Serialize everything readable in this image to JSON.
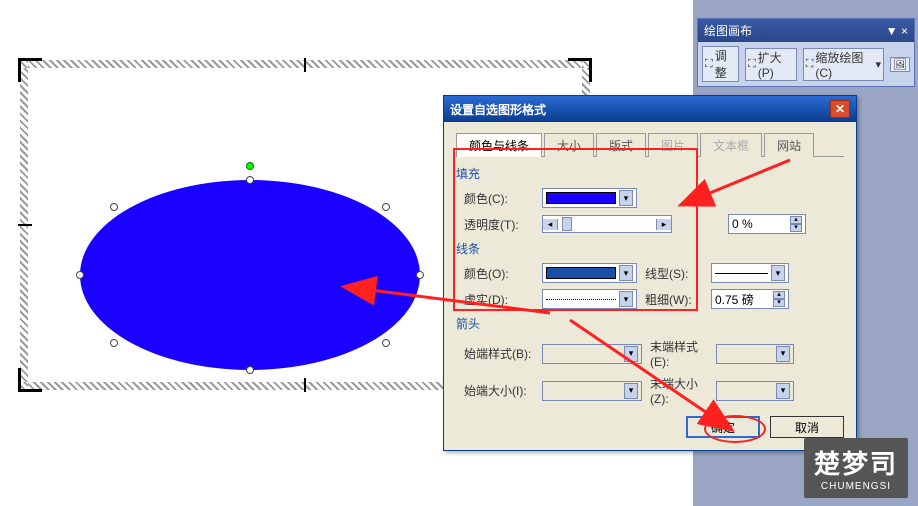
{
  "toolbar": {
    "title": "绘图画布",
    "adjust": "调整",
    "expand": "扩大(P)",
    "scale": "缩放绘图(C)"
  },
  "dialog": {
    "title": "设置自选图形格式",
    "tabs": {
      "colors": "颜色与线条",
      "size": "大小",
      "layout": "版式",
      "picture": "图片",
      "textbox": "文本框",
      "web": "网站"
    },
    "fill": {
      "section": "填充",
      "color_label": "颜色(C):",
      "color_value": "#1a00ff",
      "transparency_label": "透明度(T):",
      "transparency_value": "0 %"
    },
    "line": {
      "section": "线条",
      "color_label": "颜色(O):",
      "color_value": "#1a4fa8",
      "dash_label": "虚实(D):",
      "style_label": "线型(S):",
      "weight_label": "粗细(W):",
      "weight_value": "0.75 磅"
    },
    "arrow": {
      "section": "箭头",
      "begin_style_label": "始端样式(B):",
      "end_style_label": "末端样式(E):",
      "begin_size_label": "始端大小(I):",
      "end_size_label": "末端大小(Z):"
    },
    "buttons": {
      "ok": "确定",
      "cancel": "取消"
    }
  },
  "watermark": {
    "big": "楚梦司",
    "small": "CHUMENGSI"
  }
}
